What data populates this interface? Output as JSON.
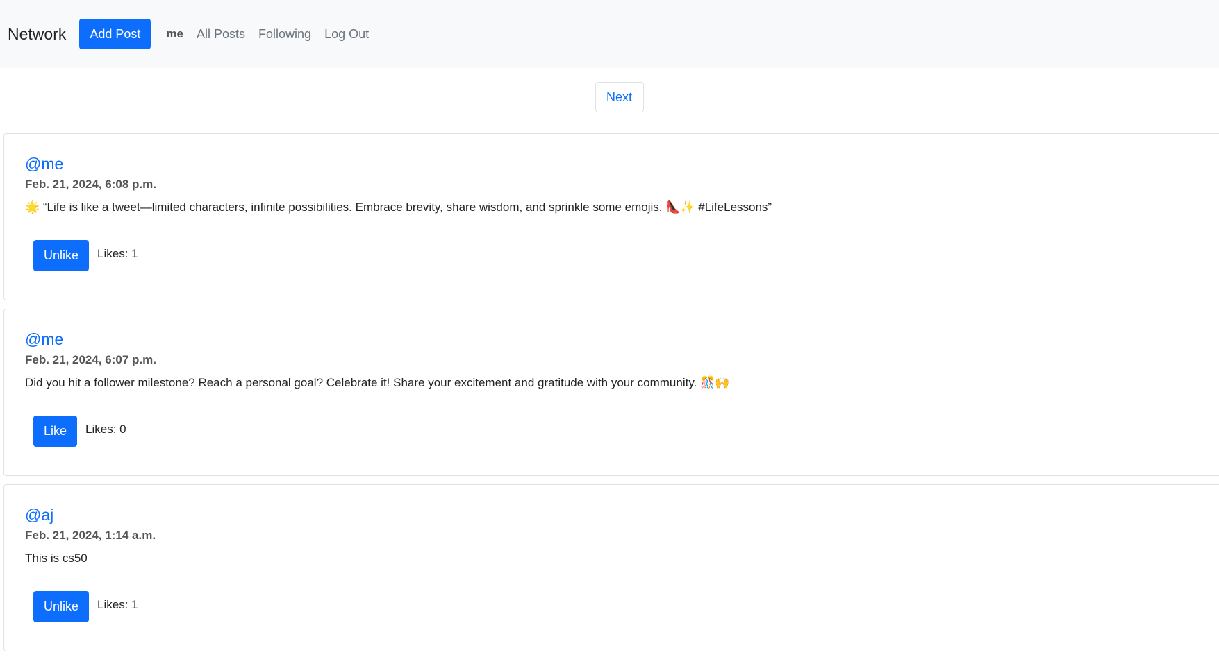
{
  "nav": {
    "brand": "Network",
    "add_post": "Add Post",
    "user": "me",
    "links": [
      "All Posts",
      "Following",
      "Log Out"
    ]
  },
  "pagination": {
    "next": "Next"
  },
  "posts": [
    {
      "username": "@me",
      "timestamp": "Feb. 21, 2024, 6:08 p.m.",
      "content": "🌟 “Life is like a tweet—limited characters, infinite possibilities. Embrace brevity, share wisdom, and sprinkle some emojis. 👠✨ #LifeLessons”",
      "button": "Unlike",
      "likes": "Likes: 1"
    },
    {
      "username": "@me",
      "timestamp": "Feb. 21, 2024, 6:07 p.m.",
      "content": "Did you hit a follower milestone? Reach a personal goal? Celebrate it! Share your excitement and gratitude with your community. 🎊🙌",
      "button": "Like",
      "likes": "Likes: 0"
    },
    {
      "username": "@aj",
      "timestamp": "Feb. 21, 2024, 1:14 a.m.",
      "content": "This is cs50",
      "button": "Unlike",
      "likes": "Likes: 1"
    }
  ],
  "colors": {
    "primary": "#0d6efd",
    "navbar_bg": "#f8f9fa"
  }
}
